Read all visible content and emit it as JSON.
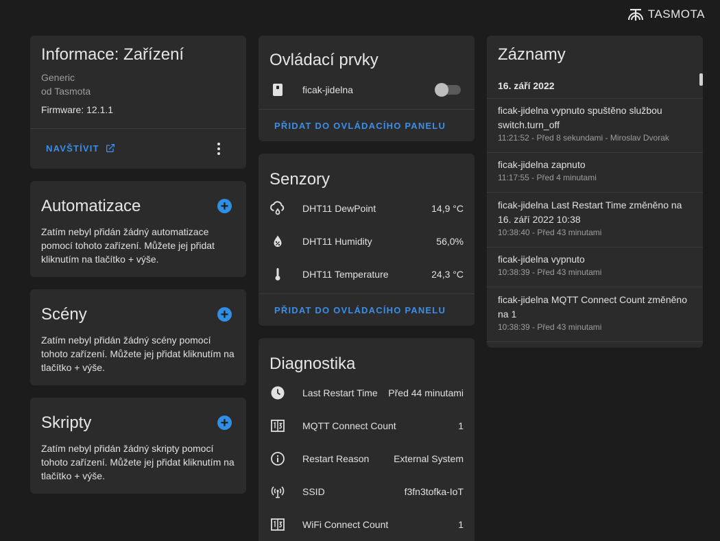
{
  "brand": {
    "name": "TASMOTA"
  },
  "device_info": {
    "title": "Informace: Zařízení",
    "model": "Generic",
    "manufacturer": "od Tasmota",
    "firmware": "Firmware: 12.1.1",
    "visit_label": "NAVŠTÍVIT"
  },
  "automations": {
    "title": "Automatizace",
    "text": "Zatím nebyl přidán žádný automatizace pomocí tohoto zařízení. Můžete jej přidat kliknutím na tlačítko + výše."
  },
  "scenes": {
    "title": "Scény",
    "text": "Zatím nebyl přidán žádný scény pomocí tohoto zařízení. Můžete jej přidat kliknutím na tlačítko + výše."
  },
  "scripts": {
    "title": "Skripty",
    "text": "Zatím nebyl přidán žádný skripty pomocí tohoto zařízení. Můžete jej přidat kliknutím na tlačítko + výše."
  },
  "controls": {
    "title": "Ovládací prvky",
    "items": [
      {
        "name": "ficak-jidelna",
        "state": "off",
        "icon": "switch-icon"
      }
    ],
    "add_label": "PŘIDAT DO OVLÁDACÍHO PANELU"
  },
  "sensors": {
    "title": "Senzory",
    "items": [
      {
        "name": "DHT11 DewPoint",
        "value": "14,9 °C",
        "icon": "weather-rain-icon"
      },
      {
        "name": "DHT11 Humidity",
        "value": "56,0%",
        "icon": "water-percent-icon"
      },
      {
        "name": "DHT11 Temperature",
        "value": "24,3 °C",
        "icon": "thermometer-icon"
      }
    ],
    "add_label": "PŘIDAT DO OVLÁDACÍHO PANELU"
  },
  "diagnostics": {
    "title": "Diagnostika",
    "items": [
      {
        "name": "Last Restart Time",
        "value": "Před 44 minutami",
        "icon": "clock-icon"
      },
      {
        "name": "MQTT Connect Count",
        "value": "1",
        "icon": "counter-icon"
      },
      {
        "name": "Restart Reason",
        "value": "External System",
        "icon": "info-icon"
      },
      {
        "name": "SSID",
        "value": "f3fn3tofka-IoT",
        "icon": "access-point-icon"
      },
      {
        "name": "WiFi Connect Count",
        "value": "1",
        "icon": "counter-icon"
      }
    ]
  },
  "logbook": {
    "title": "Záznamy",
    "date": "16. září 2022",
    "entries": [
      {
        "line1": "ficak-jidelna vypnuto spuštěno službou",
        "line2": "switch.turn_off",
        "meta": "11:21:52 - Před 8 sekundami - Miroslav Dvorak"
      },
      {
        "line1": "ficak-jidelna zapnuto",
        "line2": "",
        "meta": "11:17:55 - Před 4 minutami"
      },
      {
        "line1": "ficak-jidelna Last Restart Time změněno na",
        "line2": "16. září 2022 10:38",
        "meta": "10:38:40 - Před 43 minutami"
      },
      {
        "line1": "ficak-jidelna vypnuto",
        "line2": "",
        "meta": "10:38:39 - Před 43 minutami"
      },
      {
        "line1": "ficak-jidelna MQTT Connect Count změněno",
        "line2": "na 1",
        "meta": "10:38:39 - Před 43 minutami"
      }
    ]
  },
  "colors": {
    "accent": "#3b8eea",
    "card": "#2b2b2b",
    "background": "#1c1c1c"
  }
}
